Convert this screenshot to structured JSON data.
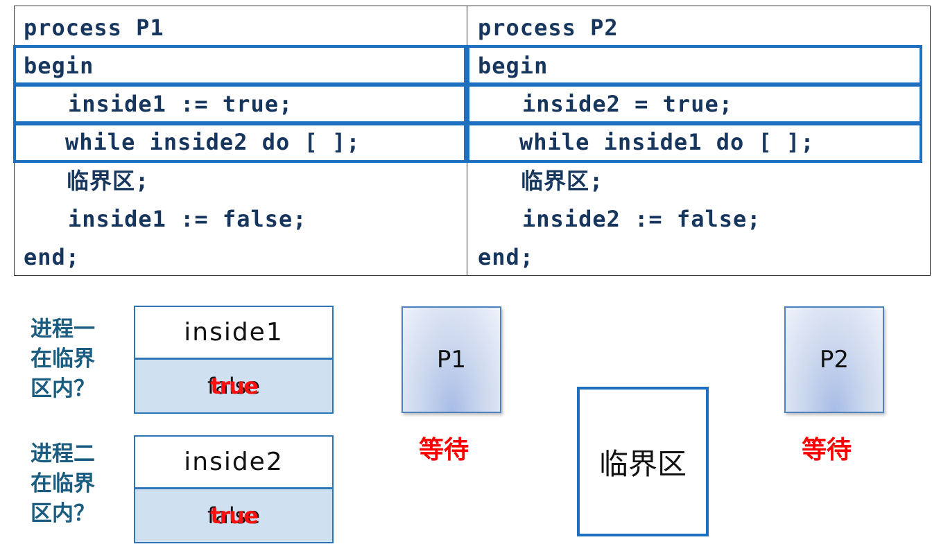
{
  "code": {
    "p1": {
      "header": "process P1",
      "lines": [
        "begin",
        "inside1 := true;",
        "while inside2 do [ ];",
        "临界区;",
        "inside1 := false;",
        "end;"
      ]
    },
    "p2": {
      "header": "process P2",
      "lines": [
        "begin",
        "inside2 = true;",
        "while inside1 do [ ];",
        "临界区;",
        "inside2 := false;",
        "end;"
      ]
    }
  },
  "colors": {
    "highlight": "#1f6fc0",
    "code_text": "#17365d",
    "question_text": "#1a5d80",
    "wait_text": "#ff0000",
    "value_fill": "#cfe0f1"
  },
  "questions": {
    "q1": [
      "进程一",
      "在临界",
      "区内？"
    ],
    "q2": [
      "进程二",
      "在临界",
      "区内？"
    ]
  },
  "variables": [
    {
      "name": "inside1",
      "old_value": "false",
      "new_value": "true"
    },
    {
      "name": "inside2",
      "old_value": "false",
      "new_value": "true"
    }
  ],
  "processes": {
    "p1": {
      "label": "P1",
      "status": "等待"
    },
    "p2": {
      "label": "P2",
      "status": "等待"
    }
  },
  "critical_section": {
    "label": "临界区"
  }
}
